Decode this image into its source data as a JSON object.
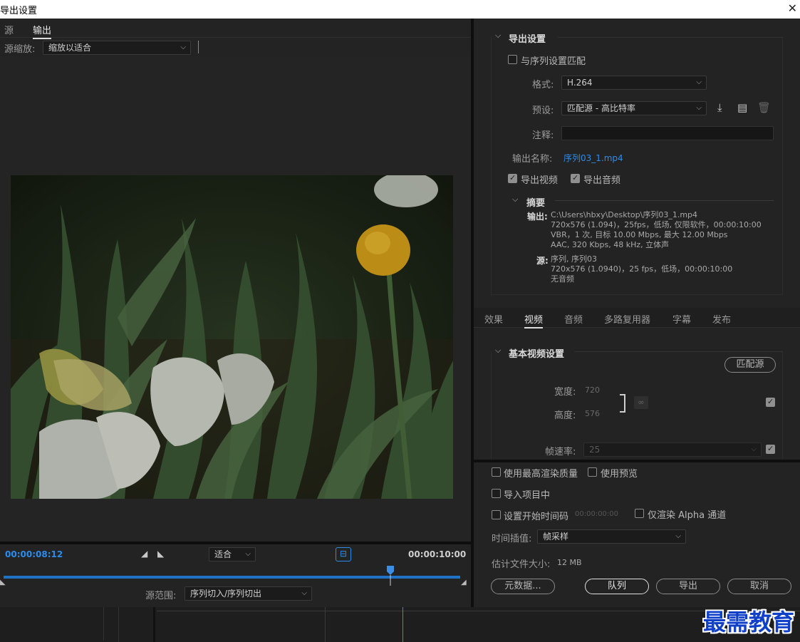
{
  "window": {
    "title": "导出设置",
    "close": "✕"
  },
  "left": {
    "tabs": [
      "源",
      "输出"
    ],
    "scale_label": "源缩放:",
    "scale_value": "缩放以适合",
    "current_time": "00:00:08:12",
    "zoom_value": "适合",
    "end_time": "00:00:10:00",
    "progress": 0.847,
    "range_label": "源范围:",
    "range_value": "序列切入/序列切出"
  },
  "export": {
    "section_title": "导出设置",
    "match_sequence": "与序列设置匹配",
    "format_label": "格式:",
    "format_value": "H.264",
    "preset_label": "预设:",
    "preset_value": "匹配源 - 高比特率",
    "comment_label": "注释:",
    "output_name_label": "输出名称:",
    "output_name": "序列03_1.mp4",
    "export_video": "导出视频",
    "export_audio": "导出音频",
    "summary_title": "摘要",
    "output_label": "输出:",
    "output_lines": [
      "C:\\Users\\hbxy\\Desktop\\序列03_1.mp4",
      "720x576 (1.094)，25fps，低场, 仅限软件，00:00:10:00",
      "VBR，1 次, 目标 10.00 Mbps, 最大 12.00 Mbps",
      "AAC, 320 Kbps, 48 kHz, 立体声"
    ],
    "source_label": "源:",
    "source_lines": [
      "序列, 序列03",
      "720x576 (1.0940)，25 fps，低场，00:00:10:00",
      "无音频"
    ]
  },
  "right_tabs": [
    "效果",
    "视频",
    "音频",
    "多路复用器",
    "字幕",
    "发布"
  ],
  "video": {
    "section_title": "基本视频设置",
    "match_source": "匹配源",
    "width_label": "宽度:",
    "width_value": "720",
    "height_label": "高度:",
    "height_value": "576",
    "fps_label": "帧速率:",
    "fps_value": "25"
  },
  "options": {
    "max_render": "使用最高渲染质量",
    "use_preview": "使用预览",
    "import_project": "导入项目中",
    "set_timecode": "设置开始时间码",
    "timecode_value": "00:00:00:00",
    "alpha_only": "仅渲染 Alpha 通道",
    "interp_label": "时间插值:",
    "interp_value": "帧采样",
    "filesize_label": "估计文件大小:",
    "filesize_value": "12 MB"
  },
  "buttons": {
    "metadata": "元数据...",
    "queue": "队列",
    "export": "导出",
    "cancel": "取消"
  },
  "watermark": "最需教育",
  "colors": {
    "accent": "#2d8ceb",
    "panel": "#232323"
  }
}
